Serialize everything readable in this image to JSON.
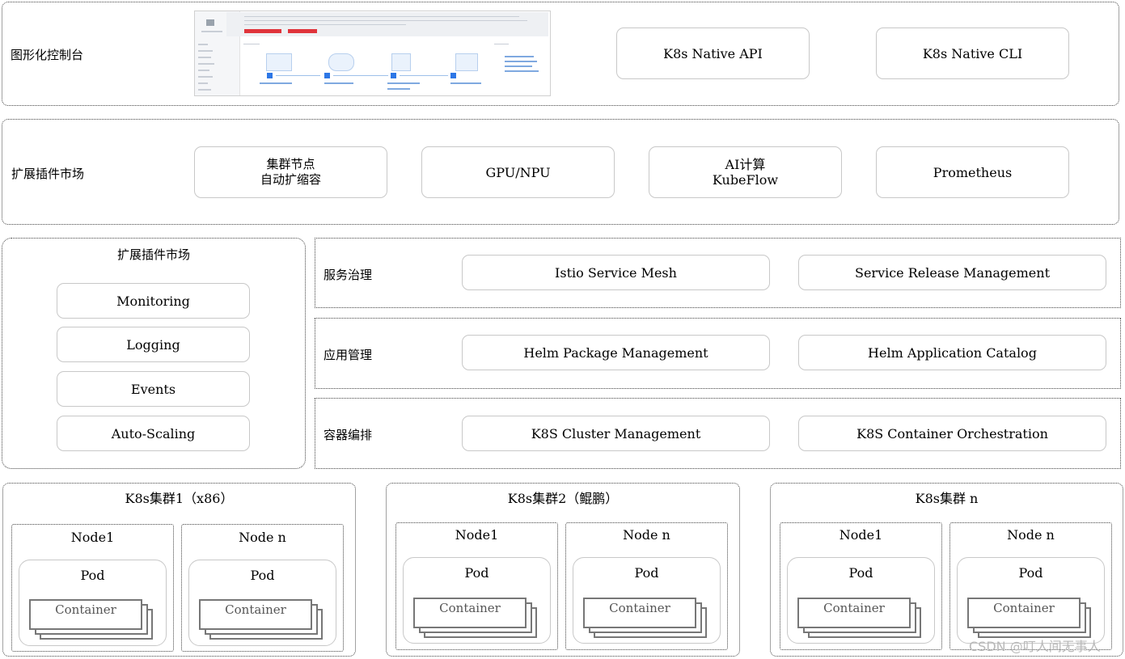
{
  "console_row": {
    "label": "图形化控制台",
    "api": "K8s Native API",
    "cli": "K8s Native CLI"
  },
  "plugin_row": {
    "label": "扩展插件市场",
    "items": [
      "集群节点",
      "自动扩缩容",
      "GPU/NPU",
      "AI计算",
      "KubeFlow",
      "Prometheus"
    ]
  },
  "ops_panel": {
    "title": "扩展插件市场",
    "items": [
      "Monitoring",
      "Logging",
      "Events",
      "Auto-Scaling"
    ]
  },
  "rows": [
    {
      "label": "服务治理",
      "left": "Istio Service Mesh",
      "right": "Service Release Management"
    },
    {
      "label": "应用管理",
      "left": "Helm Package Management",
      "right": "Helm Application Catalog"
    },
    {
      "label": "容器编排",
      "left": "K8S Cluster Management",
      "right": "K8S Container Orchestration"
    }
  ],
  "clusters": [
    {
      "title": "K8s集群1（x86）",
      "node_a": "Node1",
      "node_b": "Node n"
    },
    {
      "title": "K8s集群2（鲲鹏）",
      "node_a": "Node1",
      "node_b": "Node n"
    },
    {
      "title": "K8s集群 n",
      "node_a": "Node1",
      "node_b": "Node n"
    }
  ],
  "pod_label": "Pod",
  "container_label": "Container",
  "watermark": "CSDN @叮人间无事人"
}
